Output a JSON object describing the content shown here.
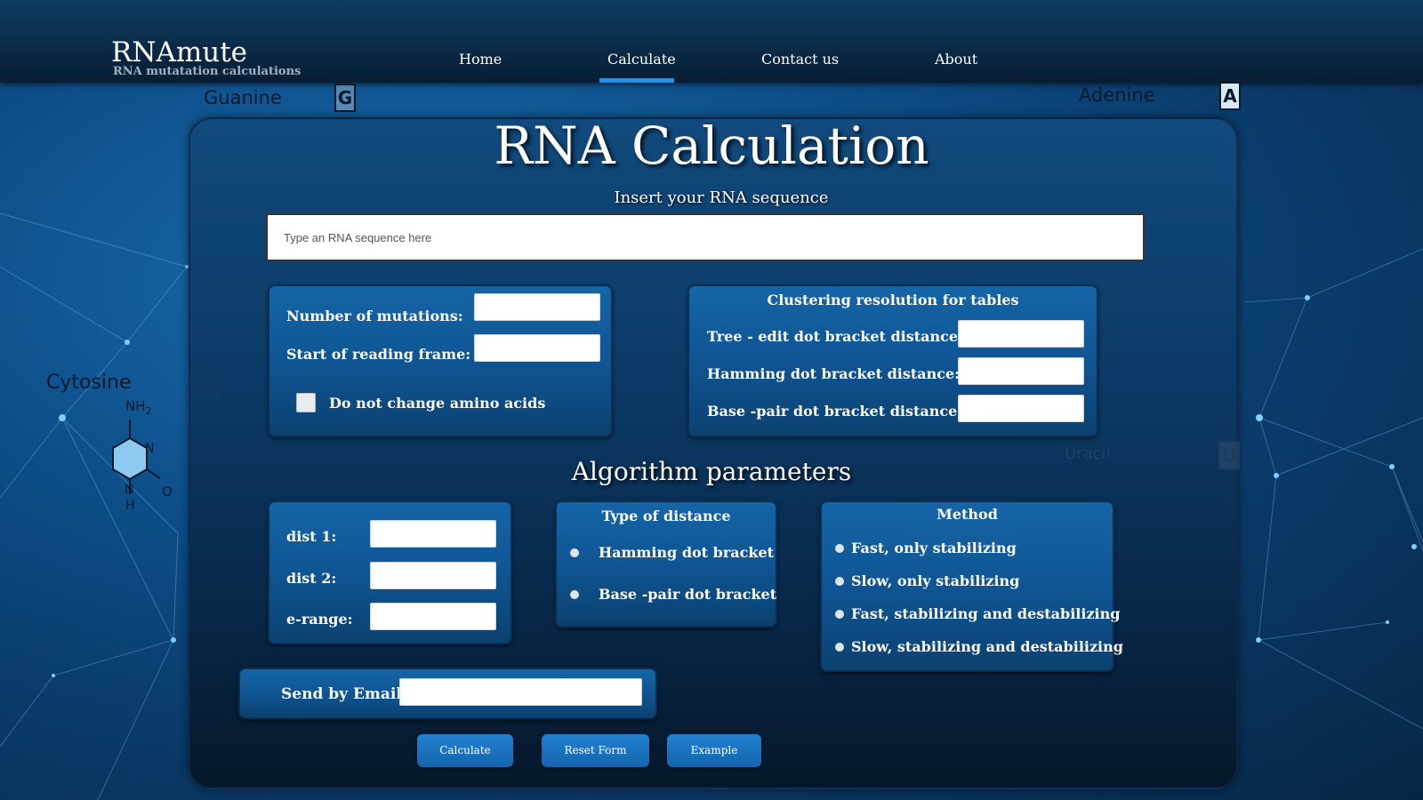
{
  "brand": {
    "title": "RNAmute",
    "subtitle": "RNA mutatation calculations"
  },
  "nav": {
    "home": "Home",
    "calculate": "Calculate",
    "contact": "Contact us",
    "about": "About"
  },
  "background_labels": {
    "guanine": "Guanine",
    "guanine_letter": "G",
    "adenine": "Adenine",
    "adenine_letter": "A",
    "cytosine": "Cytosine",
    "cytosine_letter": "C",
    "uracil": "Uracil",
    "uracil_letter": "U",
    "nh2": "NH",
    "nh2_sub": "2",
    "n": "N",
    "h": "H",
    "o": "O"
  },
  "main": {
    "title": "RNA Calculation",
    "insert_label": "Insert your RNA sequence",
    "rna_placeholder": "Type an RNA sequence here"
  },
  "mutations_box": {
    "mutations_label": "Number of mutations:",
    "reading_frame_label": "Start of reading frame:",
    "amino_acids_label": "Do not change amino acids"
  },
  "clustering_box": {
    "title": "Clustering resolution for tables",
    "tree_edit_label": "Tree - edit dot bracket distance:",
    "hamming_label": "Hamming dot bracket distance:",
    "base_pair_label": "Base -pair dot bracket distance:"
  },
  "algorithm": {
    "title": "Algorithm parameters",
    "dist1_label": "dist 1:",
    "dist2_label": "dist 2:",
    "erange_label": "e-range:",
    "distance_type": {
      "title": "Type of distance",
      "options": [
        "Hamming dot bracket",
        "Base -pair dot bracket"
      ]
    },
    "method": {
      "title": "Method",
      "options": [
        "Fast, only stabilizing",
        "Slow, only stabilizing",
        "Fast, stabilizing and destabilizing",
        "Slow, stabilizing and destabilizing"
      ]
    }
  },
  "email": {
    "label": "Send by Email"
  },
  "buttons": {
    "calculate": "Calculate",
    "reset": "Reset Form",
    "example": "Example"
  },
  "colors": {
    "accent": "#2a8fd8",
    "button": "#1a72c0",
    "panel": "#0b3762",
    "box": "#1565a6"
  }
}
